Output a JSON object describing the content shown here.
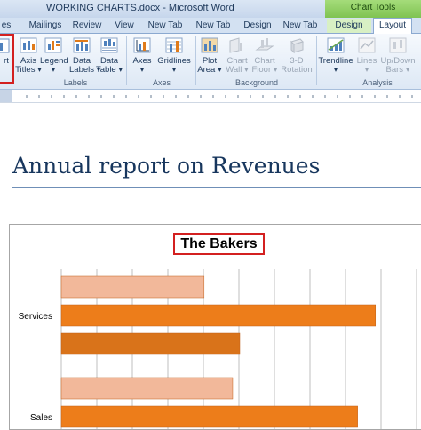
{
  "window": {
    "title": "WORKING CHARTS.docx - Microsoft Word",
    "context_header": "Chart Tools"
  },
  "tabs": [
    {
      "label": "es"
    },
    {
      "label": "Mailings"
    },
    {
      "label": "Review"
    },
    {
      "label": "View"
    },
    {
      "label": "New Tab"
    },
    {
      "label": "New Tab"
    },
    {
      "label": "Design"
    },
    {
      "label": "New Tab"
    },
    {
      "label": "Design"
    },
    {
      "label": "Layout"
    }
  ],
  "ribbon": {
    "buttons": [
      {
        "label1": "rt",
        "label2": "",
        "icon": "insert-chart-icon"
      },
      {
        "label1": "Axis",
        "label2": "Titles ▾",
        "icon": "axis-titles-icon"
      },
      {
        "label1": "Legend",
        "label2": "▾",
        "icon": "legend-icon"
      },
      {
        "label1": "Data",
        "label2": "Labels ▾",
        "icon": "data-labels-icon"
      },
      {
        "label1": "Data",
        "label2": "Table ▾",
        "icon": "data-table-icon"
      },
      {
        "label1": "Axes",
        "label2": "▾",
        "icon": "axes-icon"
      },
      {
        "label1": "Gridlines",
        "label2": "▾",
        "icon": "gridlines-icon"
      },
      {
        "label1": "Plot",
        "label2": "Area ▾",
        "icon": "plot-area-icon"
      },
      {
        "label1": "Chart",
        "label2": "Wall ▾",
        "icon": "chart-wall-icon"
      },
      {
        "label1": "Chart",
        "label2": "Floor ▾",
        "icon": "chart-floor-icon"
      },
      {
        "label1": "3-D",
        "label2": "Rotation",
        "icon": "3d-rotation-icon"
      },
      {
        "label1": "Trendline",
        "label2": "▾",
        "icon": "trendline-icon"
      },
      {
        "label1": "Lines",
        "label2": "▾",
        "icon": "lines-icon"
      },
      {
        "label1": "Up/Down",
        "label2": "Bars ▾",
        "icon": "up-down-bars-icon"
      }
    ],
    "groups": {
      "labels": "Labels",
      "axes": "Axes",
      "background": "Background",
      "analysis": "Analysis"
    }
  },
  "document": {
    "heading": "Annual report on Revenues"
  },
  "chart_data": {
    "type": "bar",
    "orientation": "horizontal",
    "title": "The Bakers",
    "categories": [
      "Services",
      "Sales"
    ],
    "series": [
      {
        "values": [
          40,
          48
        ],
        "color": "#f2b89a"
      },
      {
        "values": [
          88,
          83
        ],
        "color": "#ed7d1a"
      },
      {
        "values": [
          50,
          null
        ],
        "color": "#d9731a"
      }
    ],
    "grid": true,
    "legend": "none"
  },
  "colors": {
    "accent": "#d32020",
    "context_tab": "#7fc352",
    "heading": "#17365d"
  }
}
